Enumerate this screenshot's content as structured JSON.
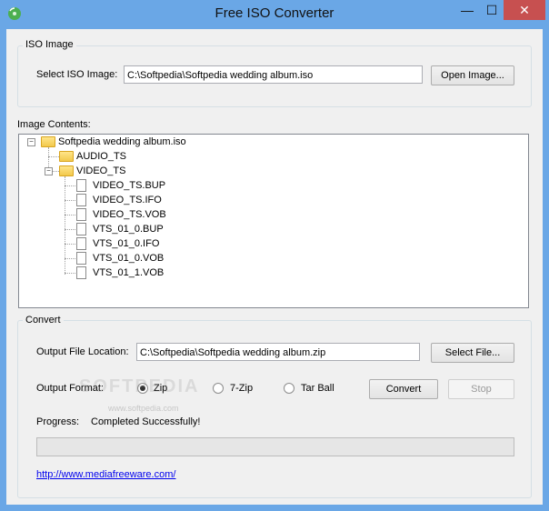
{
  "window": {
    "title": "Free ISO Converter",
    "minimize_glyph": "—",
    "maximize_glyph": "☐",
    "close_glyph": "✕"
  },
  "iso_group": {
    "legend": "ISO Image",
    "select_label": "Select ISO Image:",
    "path_value": "C:\\Softpedia\\Softpedia wedding album.iso",
    "open_button": "Open Image..."
  },
  "contents": {
    "label": "Image Contents:",
    "root": "Softpedia wedding album.iso",
    "folders": [
      "AUDIO_TS",
      "VIDEO_TS"
    ],
    "files": [
      "VIDEO_TS.BUP",
      "VIDEO_TS.IFO",
      "VIDEO_TS.VOB",
      "VTS_01_0.BUP",
      "VTS_01_0.IFO",
      "VTS_01_0.VOB",
      "VTS_01_1.VOB"
    ]
  },
  "convert_group": {
    "legend": "Convert",
    "output_label": "Output File Location:",
    "output_value": "C:\\Softpedia\\Softpedia wedding album.zip",
    "select_button": "Select File...",
    "format_label": "Output Format:",
    "formats": [
      {
        "label": "Zip",
        "selected": true
      },
      {
        "label": "7-Zip",
        "selected": false
      },
      {
        "label": "Tar Ball",
        "selected": false
      }
    ],
    "convert_button": "Convert",
    "stop_button": "Stop",
    "progress_label": "Progress:",
    "progress_status": "Completed Successfully!",
    "progress_fraction": 0
  },
  "link": "http://www.mediafreeware.com/",
  "watermark": "SOFTPEDIA",
  "watermark_url": "www.softpedia.com"
}
